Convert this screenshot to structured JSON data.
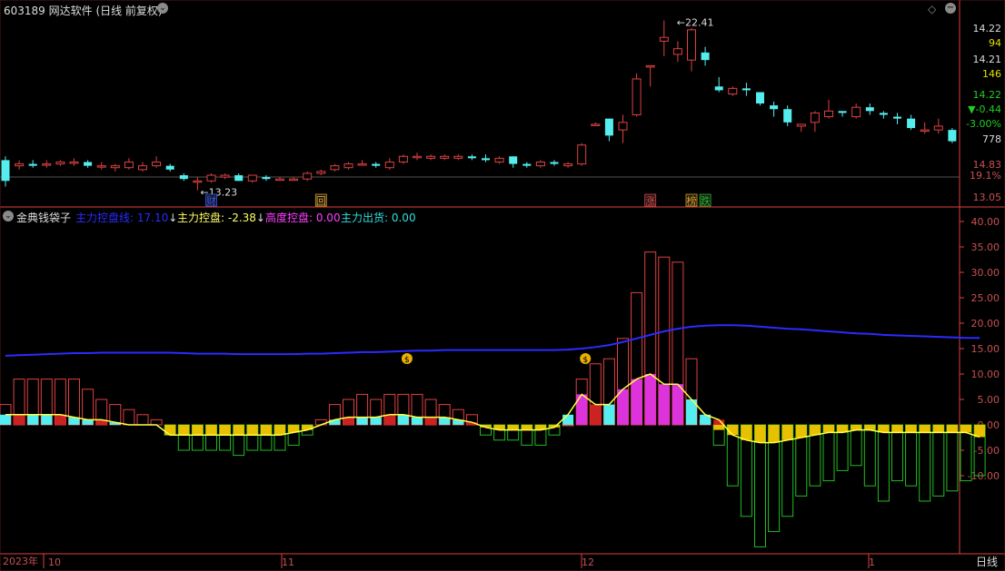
{
  "header": {
    "title": "603189 网达软件 (日线 前复权)",
    "indicator_name": "金典钱袋子",
    "legend": [
      {
        "label": "主力控盘线: 17.10",
        "arrow": "↓",
        "color": "#2b2bff"
      },
      {
        "label": "主力控盘: -2.38",
        "arrow": "↓",
        "color": "#ffff66"
      },
      {
        "label": "高度控盘: 0.00",
        "arrow": "",
        "color": "#ff40ff"
      },
      {
        "label": "主力出货: 0.00",
        "arrow": "",
        "color": "#33dddd"
      }
    ]
  },
  "right_panel": {
    "v1": "14.22",
    "v2": "94",
    "v3": "14.21",
    "v4": "146",
    "v5": "14.22",
    "change": "-0.44",
    "change_pct": "-3.00%",
    "volume": "778",
    "axis_top_a": "14.83",
    "axis_top_b": "19.1%",
    "axis_top_c": "13.05",
    "panel_tab": "日线"
  },
  "bottom_axis": {
    "year": "2023年",
    "m10": "10",
    "m11": "11",
    "m12": "12",
    "m1": "1"
  },
  "chart_data": [
    {
      "type": "candlestick",
      "title": "603189 网达软件 (日线 前复权)",
      "annotations": {
        "high": "22.41",
        "low": "13.23",
        "markers": [
          "财",
          "回",
          "涨",
          "榜",
          "跌"
        ]
      },
      "candles": [
        [
          15.0,
          15.2,
          13.6,
          13.9
        ],
        [
          14.7,
          15.0,
          14.5,
          14.8
        ],
        [
          14.8,
          15.0,
          14.6,
          14.7
        ],
        [
          14.8,
          15.0,
          14.6,
          14.8
        ],
        [
          14.8,
          15.0,
          14.7,
          14.9
        ],
        [
          14.9,
          15.1,
          14.7,
          14.9
        ],
        [
          14.9,
          15.0,
          14.6,
          14.7
        ],
        [
          14.7,
          14.9,
          14.5,
          14.7
        ],
        [
          14.6,
          14.8,
          14.4,
          14.7
        ],
        [
          14.6,
          15.1,
          14.5,
          14.9
        ],
        [
          14.5,
          14.9,
          14.4,
          14.7
        ],
        [
          14.7,
          15.2,
          14.6,
          14.9
        ],
        [
          14.7,
          14.8,
          14.4,
          14.5
        ],
        [
          14.2,
          14.3,
          13.9,
          14.0
        ],
        [
          13.9,
          14.1,
          13.4,
          13.9
        ],
        [
          13.9,
          14.3,
          13.8,
          14.2
        ],
        [
          14.1,
          14.3,
          14.0,
          14.2
        ],
        [
          14.2,
          14.3,
          13.9,
          13.9
        ],
        [
          13.9,
          14.2,
          13.8,
          14.2
        ],
        [
          14.1,
          14.2,
          13.9,
          14.0
        ],
        [
          14.0,
          14.1,
          13.9,
          14.0
        ],
        [
          14.0,
          14.1,
          13.9,
          14.0
        ],
        [
          14.0,
          14.4,
          13.9,
          14.3
        ],
        [
          14.3,
          14.5,
          14.2,
          14.4
        ],
        [
          14.5,
          14.8,
          14.4,
          14.7
        ],
        [
          14.6,
          14.9,
          14.5,
          14.8
        ],
        [
          14.8,
          15.0,
          14.7,
          14.8
        ],
        [
          14.8,
          14.9,
          14.6,
          14.7
        ],
        [
          14.6,
          15.1,
          14.5,
          14.9
        ],
        [
          14.9,
          15.3,
          14.8,
          15.2
        ],
        [
          15.2,
          15.4,
          15.0,
          15.2
        ],
        [
          15.1,
          15.3,
          15.0,
          15.2
        ],
        [
          15.1,
          15.3,
          15.0,
          15.2
        ],
        [
          15.1,
          15.3,
          15.0,
          15.2
        ],
        [
          15.2,
          15.3,
          15.0,
          15.1
        ],
        [
          15.1,
          15.3,
          14.9,
          15.0
        ],
        [
          14.9,
          15.2,
          14.8,
          15.1
        ],
        [
          15.2,
          15.2,
          14.6,
          14.8
        ],
        [
          14.8,
          14.9,
          14.6,
          14.7
        ],
        [
          14.7,
          15.0,
          14.6,
          14.9
        ],
        [
          14.9,
          15.0,
          14.7,
          14.8
        ],
        [
          14.7,
          14.9,
          14.6,
          14.8
        ],
        [
          14.8,
          15.9,
          14.7,
          15.8
        ],
        [
          16.9,
          17.0,
          16.9,
          16.9
        ],
        [
          17.2,
          17.2,
          16.0,
          16.3
        ],
        [
          16.6,
          17.4,
          15.9,
          17.0
        ],
        [
          17.4,
          19.6,
          17.3,
          19.3
        ],
        [
          20.0,
          20.0,
          18.9,
          20.0
        ],
        [
          21.3,
          22.4,
          20.5,
          21.5
        ],
        [
          20.6,
          21.3,
          20.2,
          20.9
        ],
        [
          20.3,
          22.0,
          19.7,
          21.9
        ],
        [
          20.7,
          21.0,
          20.0,
          20.3
        ],
        [
          18.9,
          19.4,
          18.6,
          18.7
        ],
        [
          18.5,
          18.9,
          18.4,
          18.8
        ],
        [
          18.8,
          19.1,
          18.4,
          18.7
        ],
        [
          18.6,
          18.6,
          17.9,
          18.0
        ],
        [
          17.9,
          18.1,
          17.3,
          17.7
        ],
        [
          17.7,
          17.9,
          16.8,
          17.0
        ],
        [
          16.8,
          16.9,
          16.5,
          16.9
        ],
        [
          17.0,
          17.6,
          16.5,
          17.5
        ],
        [
          17.3,
          18.2,
          17.2,
          17.6
        ],
        [
          17.6,
          17.6,
          17.3,
          17.5
        ],
        [
          17.3,
          18.0,
          17.2,
          17.8
        ],
        [
          17.8,
          18.0,
          17.4,
          17.6
        ],
        [
          17.5,
          17.6,
          17.2,
          17.4
        ],
        [
          17.3,
          17.5,
          16.9,
          17.2
        ],
        [
          17.2,
          17.4,
          16.6,
          16.7
        ],
        [
          16.6,
          17.0,
          16.4,
          16.6
        ],
        [
          16.6,
          17.2,
          16.4,
          16.8
        ],
        [
          16.6,
          16.7,
          15.9,
          16.0
        ]
      ]
    },
    {
      "type": "bar",
      "title": "金典钱袋子",
      "ylim": [
        -25,
        42
      ],
      "yticks": [
        "40.00",
        "35.00",
        "30.00",
        "25.00",
        "20.00",
        "15.00",
        "10.00",
        "5.00",
        "0.00",
        "-5.00",
        "-10.00"
      ],
      "series": [
        {
          "name": "主力控盘",
          "values": [
            4,
            9,
            9,
            9,
            9,
            9,
            7,
            5,
            4,
            3,
            2,
            1,
            -2,
            -5,
            -5,
            -5,
            -5,
            -6,
            -5,
            -5,
            -5,
            -4,
            -2,
            1,
            4,
            5,
            6,
            5,
            6,
            6,
            6,
            5,
            4,
            3,
            2,
            -2,
            -3,
            -3,
            -4,
            -4,
            -2,
            0,
            9,
            12,
            13,
            17,
            26,
            34,
            33,
            32,
            13,
            1,
            -4,
            -12,
            -18,
            -24,
            -21,
            -18,
            -14,
            -12,
            -11,
            -9,
            -8,
            -12,
            -15,
            -11,
            -12,
            -15,
            -14,
            -13,
            -11,
            -10
          ]
        },
        {
          "name": "主力控盘线",
          "values": [
            13.6,
            13.7,
            13.8,
            13.9,
            14.0,
            14.1,
            14.1,
            14.2,
            14.2,
            14.2,
            14.2,
            14.2,
            14.2,
            14.1,
            14.0,
            14.0,
            14.0,
            13.9,
            13.9,
            13.9,
            13.9,
            13.9,
            14.0,
            14.0,
            14.1,
            14.2,
            14.3,
            14.3,
            14.4,
            14.5,
            14.6,
            14.6,
            14.7,
            14.7,
            14.7,
            14.7,
            14.7,
            14.7,
            14.7,
            14.7,
            14.7,
            14.8,
            15.0,
            15.3,
            15.7,
            16.3,
            17.0,
            17.7,
            18.4,
            18.9,
            19.3,
            19.5,
            19.6,
            19.6,
            19.5,
            19.3,
            19.1,
            18.9,
            18.8,
            18.6,
            18.4,
            18.2,
            18.0,
            17.9,
            17.7,
            17.6,
            17.5,
            17.4,
            17.3,
            17.2,
            17.1,
            17.1
          ]
        },
        {
          "name": "高度控盘",
          "values": [
            2,
            2,
            2,
            2,
            2,
            1.5,
            1,
            1,
            0.5,
            0,
            0,
            0,
            0,
            0,
            0,
            0,
            0,
            0,
            0,
            0,
            0,
            0,
            0,
            0,
            1,
            1.5,
            1.5,
            1.5,
            2,
            2,
            1.5,
            1.5,
            1.5,
            1,
            0.5,
            0,
            0,
            0,
            0,
            0,
            0,
            2,
            6,
            4,
            4,
            7,
            9,
            10,
            8,
            8,
            5,
            2,
            1,
            0,
            0,
            0,
            0,
            0,
            0,
            0,
            0,
            0,
            0,
            0,
            0,
            0,
            0,
            0,
            0,
            0,
            0,
            0
          ]
        },
        {
          "name": "主力出货",
          "values": [
            0,
            0,
            0,
            0,
            0,
            0,
            0,
            0,
            0,
            0,
            0,
            0,
            -2,
            -2,
            -2,
            -2,
            -2,
            -2,
            -2,
            -2,
            -2,
            -1.5,
            -1,
            0,
            0,
            0,
            0,
            0,
            0,
            0,
            0,
            0,
            0,
            0,
            0,
            -0.5,
            -1,
            -1,
            -1,
            -1,
            -0.5,
            0,
            0,
            0,
            0,
            0,
            0,
            0,
            0,
            0,
            0,
            0,
            -1,
            -2,
            -3,
            -3.5,
            -3.5,
            -3,
            -2.5,
            -2,
            -1.5,
            -1.5,
            -1,
            -1,
            -1.5,
            -1.5,
            -1.5,
            -1.5,
            -1.5,
            -1.5,
            -1.5,
            -2.4
          ]
        }
      ],
      "money_bag_marks": [
        29,
        42
      ]
    }
  ]
}
